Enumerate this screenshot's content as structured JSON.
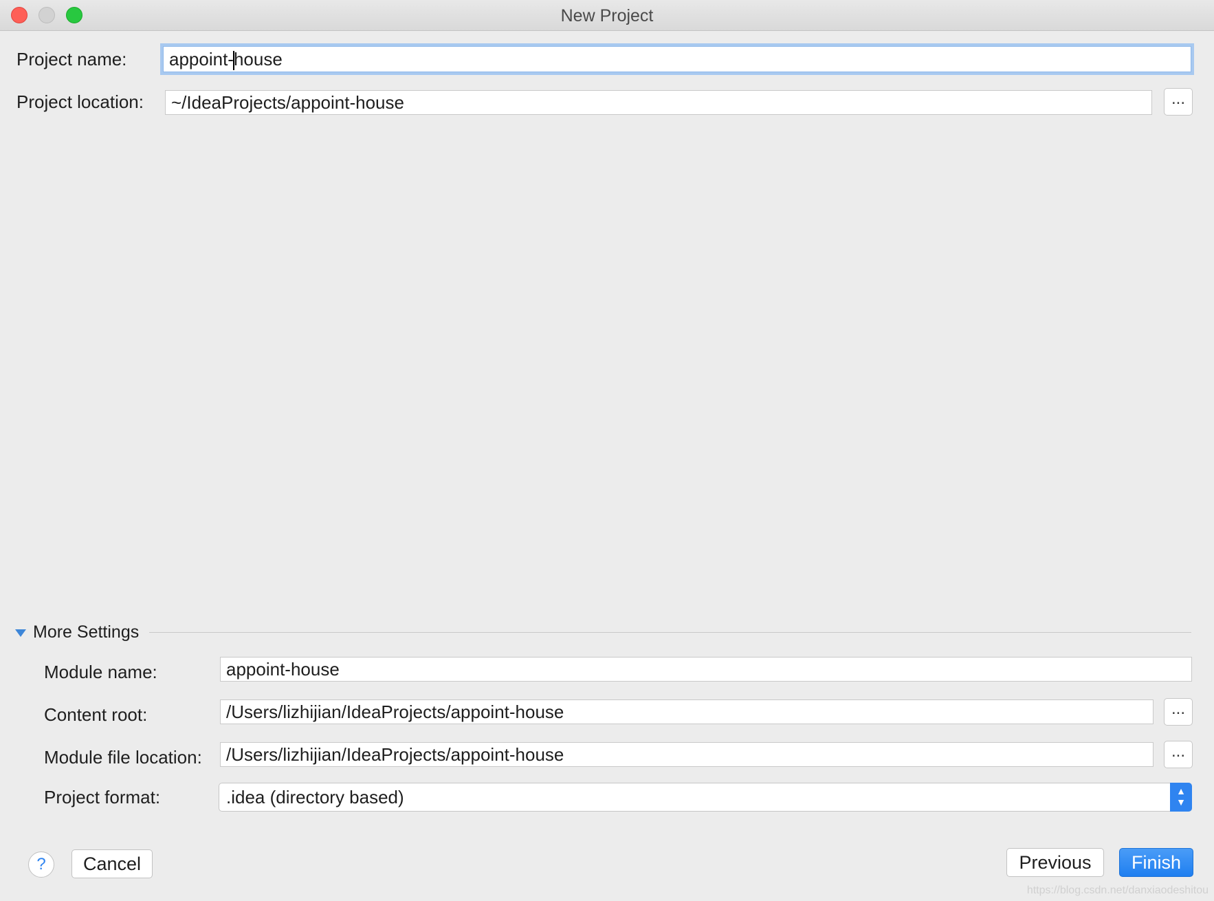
{
  "window": {
    "title": "New Project"
  },
  "project": {
    "name_label": "Project name:",
    "name_value_before_caret": "appoint-",
    "name_value_after_caret": "house",
    "location_label": "Project location:",
    "location_value": "~/IdeaProjects/appoint-house",
    "browse_label": "..."
  },
  "more_settings": {
    "header": "More Settings",
    "module_name_label": "Module name:",
    "module_name_value": "appoint-house",
    "content_root_label": "Content root:",
    "content_root_value": "/Users/lizhijian/IdeaProjects/appoint-house",
    "module_file_label": "Module file location:",
    "module_file_value": "/Users/lizhijian/IdeaProjects/appoint-house",
    "format_label": "Project format:",
    "format_value": ".idea (directory based)",
    "browse_label": "..."
  },
  "footer": {
    "help_label": "?",
    "cancel_label": "Cancel",
    "previous_label": "Previous",
    "finish_label": "Finish",
    "watermark": "https://blog.csdn.net/danxiaodeshitou"
  },
  "colors": {
    "accent": "#2f84f0",
    "focus_ring": "#a8c9f0",
    "background": "#ececec"
  }
}
